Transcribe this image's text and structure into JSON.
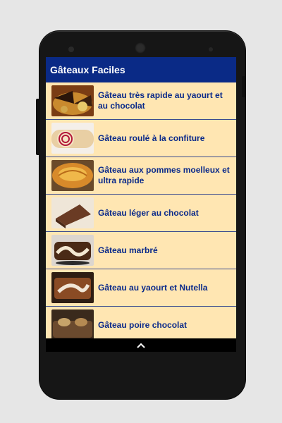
{
  "app": {
    "title": "Gâteaux Faciles"
  },
  "items": [
    {
      "label": "Gâteau très rapide au yaourt et au chocolat",
      "icon": "cake-chocolate-slices-image"
    },
    {
      "label": "Gâteau roulé à la confiture",
      "icon": "jam-roll-image"
    },
    {
      "label": "Gâteau aux pommes moelleux et ultra rapide",
      "icon": "apple-cake-image"
    },
    {
      "label": "Gâteau léger au chocolat",
      "icon": "chocolate-slice-image"
    },
    {
      "label": "Gâteau marbré",
      "icon": "marble-cake-image"
    },
    {
      "label": "Gâteau au yaourt et Nutella",
      "icon": "nutella-cake-image"
    },
    {
      "label": "Gâteau poire chocolat",
      "icon": "pear-chocolate-cake-image"
    }
  ],
  "navbar": {
    "icon": "chevron-up-icon"
  }
}
